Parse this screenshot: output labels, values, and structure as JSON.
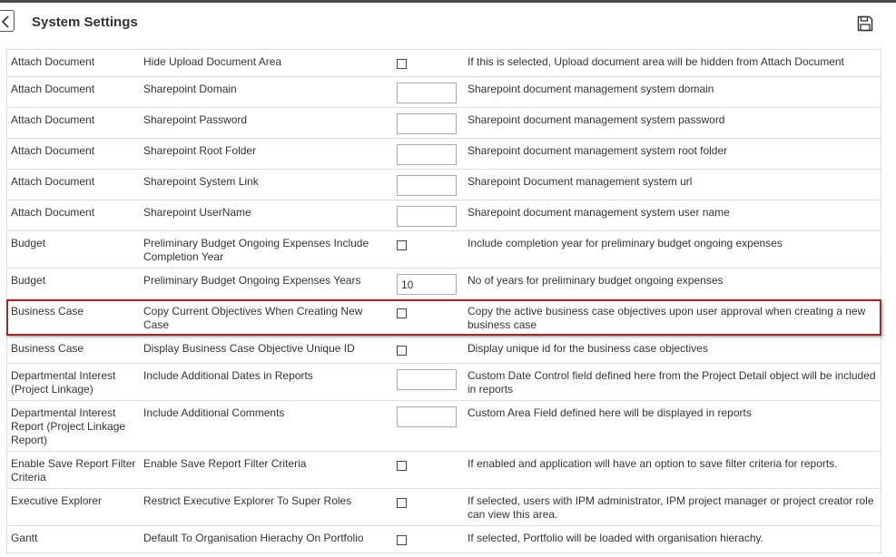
{
  "header": {
    "title": "System Settings"
  },
  "rows": [
    {
      "module": "Attach Document",
      "setting": "Hide Upload Document Area",
      "control": "checkbox",
      "value": "",
      "description": "If this is selected, Upload document area will be hidden from Attach Document"
    },
    {
      "module": "Attach Document",
      "setting": "Sharepoint Domain",
      "control": "text",
      "value": "",
      "description": "Sharepoint document management system domain"
    },
    {
      "module": "Attach Document",
      "setting": "Sharepoint Password",
      "control": "text",
      "value": "",
      "description": "Sharepoint document management system password"
    },
    {
      "module": "Attach Document",
      "setting": "Sharepoint Root Folder",
      "control": "text",
      "value": "",
      "description": "Sharepoint document management system root folder"
    },
    {
      "module": "Attach Document",
      "setting": "Sharepoint System Link",
      "control": "text",
      "value": "",
      "description": "Sharepoint Document management system url"
    },
    {
      "module": "Attach Document",
      "setting": "Sharepoint UserName",
      "control": "text",
      "value": "",
      "description": "Sharepoint document management system user name"
    },
    {
      "module": "Budget",
      "setting": "Preliminary Budget Ongoing Expenses Include Completion Year",
      "control": "checkbox",
      "value": "",
      "description": "Include completion year for preliminary budget ongoing expenses"
    },
    {
      "module": "Budget",
      "setting": "Preliminary Budget Ongoing Expenses Years",
      "control": "text",
      "value": "10",
      "description": "No of years for preliminary budget ongoing expenses"
    },
    {
      "module": "Business Case",
      "setting": "Copy Current Objectives When Creating New Case",
      "control": "checkbox",
      "value": "",
      "description": "Copy the active business case objectives upon user approval when creating a new business case"
    },
    {
      "module": "Business Case",
      "setting": "Display Business Case Objective Unique ID",
      "control": "checkbox",
      "value": "",
      "description": "Display unique id for the business case objectives"
    },
    {
      "module": "Departmental Interest (Project Linkage)",
      "setting": "Include Additional Dates in Reports",
      "control": "text",
      "value": "",
      "description": "Custom Date Control field defined here from the Project Detail object will be included in reports"
    },
    {
      "module": "Departmental Interest Report (Project Linkage Report)",
      "setting": "Include Additional Comments",
      "control": "text",
      "value": "",
      "description": "Custom Area Field defined here will be displayed in reports"
    },
    {
      "module": "Enable Save Report Filter Criteria",
      "setting": "Enable Save Report Filter Criteria",
      "control": "checkbox",
      "value": "",
      "description": "If enabled and application will have an option to save filter criteria for reports."
    },
    {
      "module": "Executive Explorer",
      "setting": "Restrict Executive Explorer To Super Roles",
      "control": "checkbox",
      "value": "",
      "description": "If selected, users with IPM administrator, IPM project manager or project creator role can view this area."
    },
    {
      "module": "Gantt",
      "setting": "Default To Organisation Hierachy On Portfolio",
      "control": "checkbox",
      "value": "",
      "description": "If selected, Portfolio will be loaded with organisation hierachy."
    }
  ]
}
